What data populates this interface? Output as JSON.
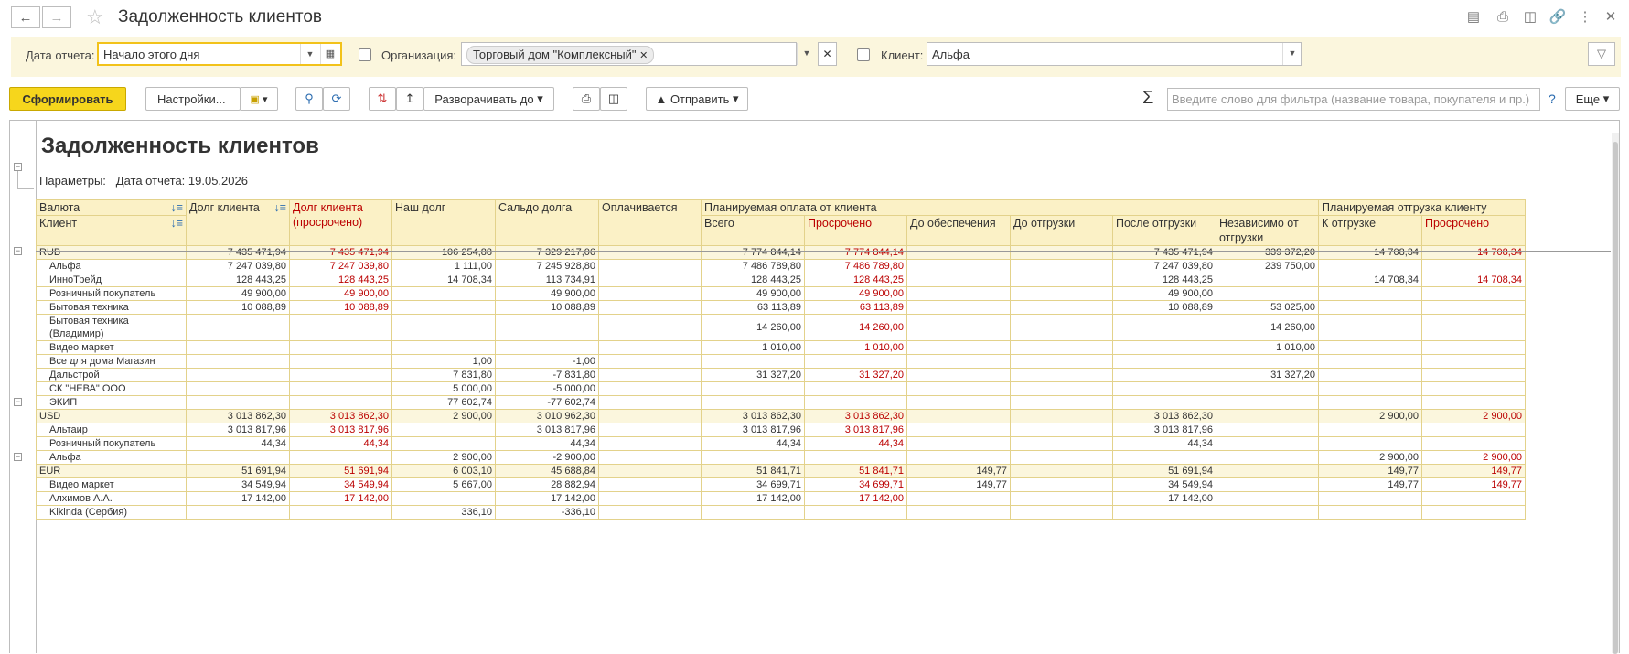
{
  "window": {
    "title": "Задолженность клиентов"
  },
  "filters": {
    "date_label": "Дата отчета:",
    "date_value": "Начало этого дня",
    "org_label": "Организация:",
    "org_value": "Торговый дом \"Комплексный\"",
    "client_label": "Клиент:",
    "client_value": "Альфа"
  },
  "toolbar": {
    "generate": "Сформировать",
    "settings": "Настройки...",
    "expand_to": "Разворачивать до",
    "send": "Отправить",
    "search_placeholder": "Введите слово для фильтра (название товара, покупателя и пр.)",
    "help": "?",
    "more": "Еще"
  },
  "report": {
    "title": "Задолженность клиентов",
    "params_label": "Параметры:",
    "params_value": "Дата отчета: 19.05.2026",
    "headers": {
      "currency": "Валюта",
      "client": "Клиент",
      "client_debt": "Долг клиента",
      "client_debt_overdue": "Долг клиента (просрочено)",
      "our_debt": "Наш долг",
      "balance": "Сальдо долга",
      "being_paid": "Оплачивается",
      "planned_payment": "Планируемая оплата от клиента",
      "total": "Всего",
      "overdue": "Просрочено",
      "before_security": "До обеспечения",
      "before_shipment": "До отгрузки",
      "after_shipment": "После отгрузки",
      "independent": "Независимо от отгрузки",
      "planned_shipment": "Планируемая отгрузка клиенту",
      "to_ship": "К отгрузке",
      "ship_overdue": "Просрочено"
    },
    "rows": [
      {
        "group": true,
        "name": "RUB",
        "v": [
          "7 435 471,94",
          "7 435 471,94",
          "106 254,88",
          "7 329 217,06",
          "",
          "7 774 844,14",
          "7 774 844,14",
          "",
          "",
          "7 435 471,94",
          "339 372,20",
          "14 708,34",
          "14 708,34"
        ]
      },
      {
        "group": false,
        "name": "Альфа",
        "v": [
          "7 247 039,80",
          "7 247 039,80",
          "1 111,00",
          "7 245 928,80",
          "",
          "7 486 789,80",
          "7 486 789,80",
          "",
          "",
          "7 247 039,80",
          "239 750,00",
          "",
          ""
        ]
      },
      {
        "group": false,
        "name": "ИнноТрейд",
        "v": [
          "128 443,25",
          "128 443,25",
          "14 708,34",
          "113 734,91",
          "",
          "128 443,25",
          "128 443,25",
          "",
          "",
          "128 443,25",
          "",
          "14 708,34",
          "14 708,34"
        ]
      },
      {
        "group": false,
        "name": "Розничный покупатель",
        "v": [
          "49 900,00",
          "49 900,00",
          "",
          "49 900,00",
          "",
          "49 900,00",
          "49 900,00",
          "",
          "",
          "49 900,00",
          "",
          "",
          ""
        ]
      },
      {
        "group": false,
        "name": "Бытовая техника",
        "v": [
          "10 088,89",
          "10 088,89",
          "",
          "10 088,89",
          "",
          "63 113,89",
          "63 113,89",
          "",
          "",
          "10 088,89",
          "53 025,00",
          "",
          ""
        ]
      },
      {
        "group": false,
        "name": "Бытовая техника",
        "name2": "(Владимир)",
        "v": [
          "",
          "",
          "",
          "",
          "",
          "14 260,00",
          "14 260,00",
          "",
          "",
          "",
          "14 260,00",
          "",
          ""
        ]
      },
      {
        "group": false,
        "name": "Видео маркет",
        "v": [
          "",
          "",
          "",
          "",
          "",
          "1 010,00",
          "1 010,00",
          "",
          "",
          "",
          "1 010,00",
          "",
          ""
        ]
      },
      {
        "group": false,
        "name": "Все для дома Магазин",
        "v": [
          "",
          "",
          "1,00",
          "-1,00",
          "",
          "",
          "",
          "",
          "",
          "",
          "",
          "",
          ""
        ]
      },
      {
        "group": false,
        "name": "Дальстрой",
        "v": [
          "",
          "",
          "7 831,80",
          "-7 831,80",
          "",
          "31 327,20",
          "31 327,20",
          "",
          "",
          "",
          "31 327,20",
          "",
          ""
        ]
      },
      {
        "group": false,
        "name": "СК \"НЕВА\" ООО",
        "v": [
          "",
          "",
          "5 000,00",
          "-5 000,00",
          "",
          "",
          "",
          "",
          "",
          "",
          "",
          "",
          ""
        ]
      },
      {
        "group": false,
        "name": "ЭКИП",
        "v": [
          "",
          "",
          "77 602,74",
          "-77 602,74",
          "",
          "",
          "",
          "",
          "",
          "",
          "",
          "",
          ""
        ]
      },
      {
        "group": true,
        "name": "USD",
        "v": [
          "3 013 862,30",
          "3 013 862,30",
          "2 900,00",
          "3 010 962,30",
          "",
          "3 013 862,30",
          "3 013 862,30",
          "",
          "",
          "3 013 862,30",
          "",
          "2 900,00",
          "2 900,00"
        ]
      },
      {
        "group": false,
        "name": "Альтаир",
        "v": [
          "3 013 817,96",
          "3 013 817,96",
          "",
          "3 013 817,96",
          "",
          "3 013 817,96",
          "3 013 817,96",
          "",
          "",
          "3 013 817,96",
          "",
          "",
          ""
        ]
      },
      {
        "group": false,
        "name": "Розничный покупатель",
        "v": [
          "44,34",
          "44,34",
          "",
          "44,34",
          "",
          "44,34",
          "44,34",
          "",
          "",
          "44,34",
          "",
          "",
          ""
        ]
      },
      {
        "group": false,
        "name": "Альфа",
        "v": [
          "",
          "",
          "2 900,00",
          "-2 900,00",
          "",
          "",
          "",
          "",
          "",
          "",
          "",
          "2 900,00",
          "2 900,00"
        ]
      },
      {
        "group": true,
        "name": "EUR",
        "v": [
          "51 691,94",
          "51 691,94",
          "6 003,10",
          "45 688,84",
          "",
          "51 841,71",
          "51 841,71",
          "149,77",
          "",
          "51 691,94",
          "",
          "149,77",
          "149,77"
        ]
      },
      {
        "group": false,
        "name": "Видео маркет",
        "v": [
          "34 549,94",
          "34 549,94",
          "5 667,00",
          "28 882,94",
          "",
          "34 699,71",
          "34 699,71",
          "149,77",
          "",
          "34 549,94",
          "",
          "149,77",
          "149,77"
        ]
      },
      {
        "group": false,
        "name": "Алхимов А.А.",
        "v": [
          "17 142,00",
          "17 142,00",
          "",
          "17 142,00",
          "",
          "17 142,00",
          "17 142,00",
          "",
          "",
          "17 142,00",
          "",
          "",
          ""
        ]
      },
      {
        "group": false,
        "name": "Kikinda (Сербия)",
        "v": [
          "",
          "",
          "336,10",
          "-336,10",
          "",
          "",
          "",
          "",
          "",
          "",
          "",
          "",
          ""
        ]
      }
    ]
  }
}
